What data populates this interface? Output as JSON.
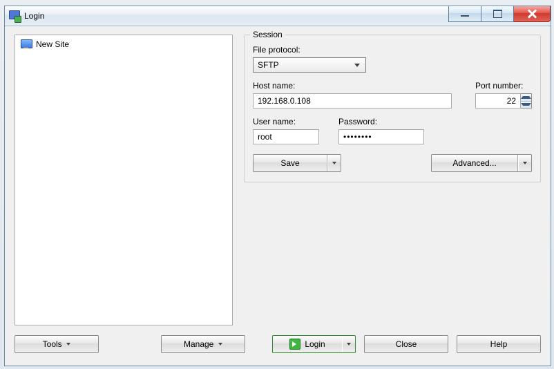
{
  "window": {
    "title": "Login"
  },
  "sites": {
    "items": [
      {
        "label": "New Site"
      }
    ]
  },
  "session": {
    "legend": "Session",
    "protocol_label": "File protocol:",
    "protocol_value": "SFTP",
    "host_label": "Host name:",
    "host_value": "192.168.0.108",
    "port_label": "Port number:",
    "port_value": "22",
    "user_label": "User name:",
    "user_value": "root",
    "password_label": "Password:",
    "password_value": "••••••••",
    "save_label": "Save",
    "advanced_label": "Advanced..."
  },
  "buttons": {
    "tools": "Tools",
    "manage": "Manage",
    "login": "Login",
    "close": "Close",
    "help": "Help"
  }
}
